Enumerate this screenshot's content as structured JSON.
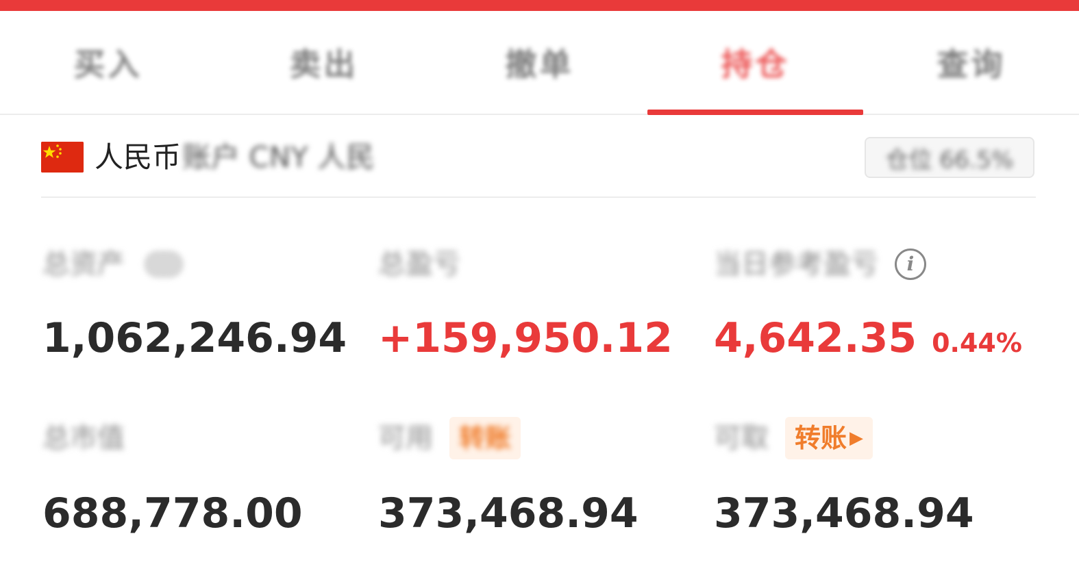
{
  "tabs": [
    {
      "label": "买入",
      "active": false
    },
    {
      "label": "卖出",
      "active": false
    },
    {
      "label": "撤单",
      "active": false
    },
    {
      "label": "持仓",
      "active": true
    },
    {
      "label": "查询",
      "active": false
    }
  ],
  "account": {
    "flag_icon": "china-flag-icon",
    "name": "人民币账户 CNY 人民",
    "name_visible": "人民币",
    "name_obscured": "账户 CNY 人民",
    "rate_label": "仓位 66.5%"
  },
  "metrics": {
    "total_assets": {
      "label": "总资产",
      "value": "1,062,246.94"
    },
    "total_pnl": {
      "label": "总盈亏",
      "value": "+159,950.12"
    },
    "today_pnl": {
      "label": "当日参考盈亏",
      "value": "4,642.35",
      "percent": "0.44%"
    },
    "market_value": {
      "label": "总市值",
      "value": "688,778.00"
    },
    "available": {
      "label": "可用",
      "tag": "转账",
      "value": "373,468.94"
    },
    "withdrawable": {
      "label": "可取",
      "tag": "转账",
      "value": "373,468.94"
    }
  },
  "colors": {
    "accent": "#e93a3a",
    "tag": "#f07d2c",
    "tag_bg": "#fff2e8"
  }
}
